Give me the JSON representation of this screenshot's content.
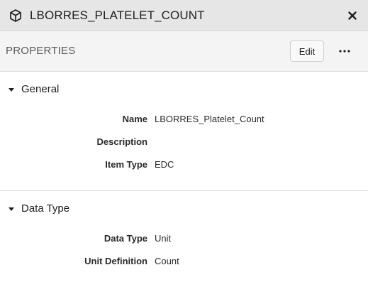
{
  "header": {
    "title": "LBORRES_PLATELET_COUNT",
    "title_icon": "cube-icon",
    "close_icon": "close-icon"
  },
  "toolbar": {
    "section_label": "PROPERTIES",
    "edit_label": "Edit",
    "more_icon": "more-horizontal-icon"
  },
  "sections": [
    {
      "title": "General",
      "expanded": true,
      "properties": [
        {
          "label": "Name",
          "value": "LBORRES_Platelet_Count"
        },
        {
          "label": "Description",
          "value": ""
        },
        {
          "label": "Item Type",
          "value": "EDC"
        }
      ]
    },
    {
      "title": "Data Type",
      "expanded": true,
      "properties": [
        {
          "label": "Data Type",
          "value": "Unit"
        },
        {
          "label": "Unit Definition",
          "value": "Count"
        }
      ]
    }
  ]
}
